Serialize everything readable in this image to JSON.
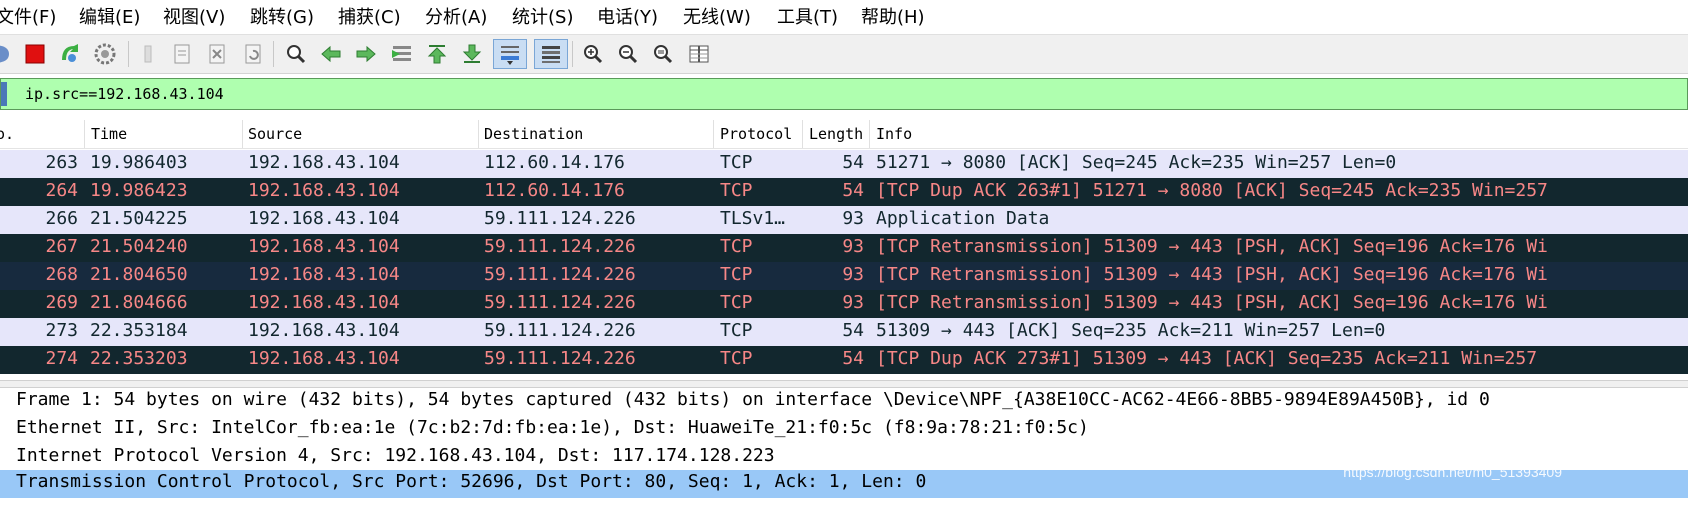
{
  "menu": [
    "文件(F)",
    "编辑(E)",
    "视图(V)",
    "跳转(G)",
    "捕获(C)",
    "分析(A)",
    "统计(S)",
    "电话(Y)",
    "无线(W)",
    "工具(T)",
    "帮助(H)"
  ],
  "toolbar": {
    "icons": [
      "start-capture-icon",
      "stop-capture-icon",
      "restart-capture-icon",
      "capture-options-icon",
      "open-file-icon",
      "save-file-icon",
      "close-file-icon",
      "reload-file-icon",
      "find-packet-icon",
      "go-back-icon",
      "go-forward-icon",
      "go-to-packet-icon",
      "go-first-icon",
      "go-last-icon",
      "autoscroll-icon",
      "colorize-icon",
      "zoom-in-icon",
      "zoom-out-icon",
      "normal-size-icon",
      "resize-columns-icon"
    ]
  },
  "filter": {
    "value": "ip.src==192.168.43.104"
  },
  "packet_list": {
    "columns": [
      "o.",
      "Time",
      "Source",
      "Destination",
      "Protocol",
      "Length",
      "Info"
    ],
    "rows": [
      {
        "no": "263",
        "time": "19.986403",
        "src": "192.168.43.104",
        "dst": "112.60.14.176",
        "proto": "TCP",
        "len": "54",
        "info": "51271 → 8080 [ACK] Seq=245 Ack=235 Win=257 Len=0",
        "style": "normal"
      },
      {
        "no": "264",
        "time": "19.986423",
        "src": "192.168.43.104",
        "dst": "112.60.14.176",
        "proto": "TCP",
        "len": "54",
        "info": "[TCP Dup ACK 263#1] 51271 → 8080 [ACK] Seq=245 Ack=235 Win=257",
        "style": "bad"
      },
      {
        "no": "266",
        "time": "21.504225",
        "src": "192.168.43.104",
        "dst": "59.111.124.226",
        "proto": "TLSv1…",
        "len": "93",
        "info": "Application Data",
        "style": "normal"
      },
      {
        "no": "267",
        "time": "21.504240",
        "src": "192.168.43.104",
        "dst": "59.111.124.226",
        "proto": "TCP",
        "len": "93",
        "info": "[TCP Retransmission] 51309 → 443 [PSH, ACK] Seq=196 Ack=176 Wi",
        "style": "bad"
      },
      {
        "no": "268",
        "time": "21.804650",
        "src": "192.168.43.104",
        "dst": "59.111.124.226",
        "proto": "TCP",
        "len": "93",
        "info": "[TCP Retransmission] 51309 → 443 [PSH, ACK] Seq=196 Ack=176 Wi",
        "style": "bad sel"
      },
      {
        "no": "269",
        "time": "21.804666",
        "src": "192.168.43.104",
        "dst": "59.111.124.226",
        "proto": "TCP",
        "len": "93",
        "info": "[TCP Retransmission] 51309 → 443 [PSH, ACK] Seq=196 Ack=176 Wi",
        "style": "bad"
      },
      {
        "no": "273",
        "time": "22.353184",
        "src": "192.168.43.104",
        "dst": "59.111.124.226",
        "proto": "TCP",
        "len": "54",
        "info": "51309 → 443 [ACK] Seq=235 Ack=211 Win=257 Len=0",
        "style": "normal"
      },
      {
        "no": "274",
        "time": "22.353203",
        "src": "192.168.43.104",
        "dst": "59.111.124.226",
        "proto": "TCP",
        "len": "54",
        "info": "[TCP Dup ACK 273#1] 51309 → 443 [ACK] Seq=235 Ack=211 Win=257",
        "style": "bad"
      }
    ]
  },
  "details": {
    "lines": [
      "Frame 1: 54 bytes on wire (432 bits), 54 bytes captured (432 bits) on interface \\Device\\NPF_{A38E10CC-AC62-4E66-8BB5-9894E89A450B}, id 0",
      "Ethernet II, Src: IntelCor_fb:ea:1e (7c:b2:7d:fb:ea:1e), Dst: HuaweiTe_21:f0:5c (f8:9a:78:21:f0:5c)",
      "Internet Protocol Version 4, Src: 192.168.43.104, Dst: 117.174.128.223",
      "Transmission Control Protocol, Src Port: 52696, Dst Port: 80, Seq: 1, Ack: 1, Len: 0"
    ]
  },
  "watermark": "https://blog.csdn.net/m0_51393409",
  "colors": {
    "bad_bg": "#12272e",
    "bad_fg": "#f78787",
    "normal_bg": "#e6e6fa",
    "filter_ok_bg": "#afffaf",
    "selected_detail_bg": "#99c8f7"
  }
}
